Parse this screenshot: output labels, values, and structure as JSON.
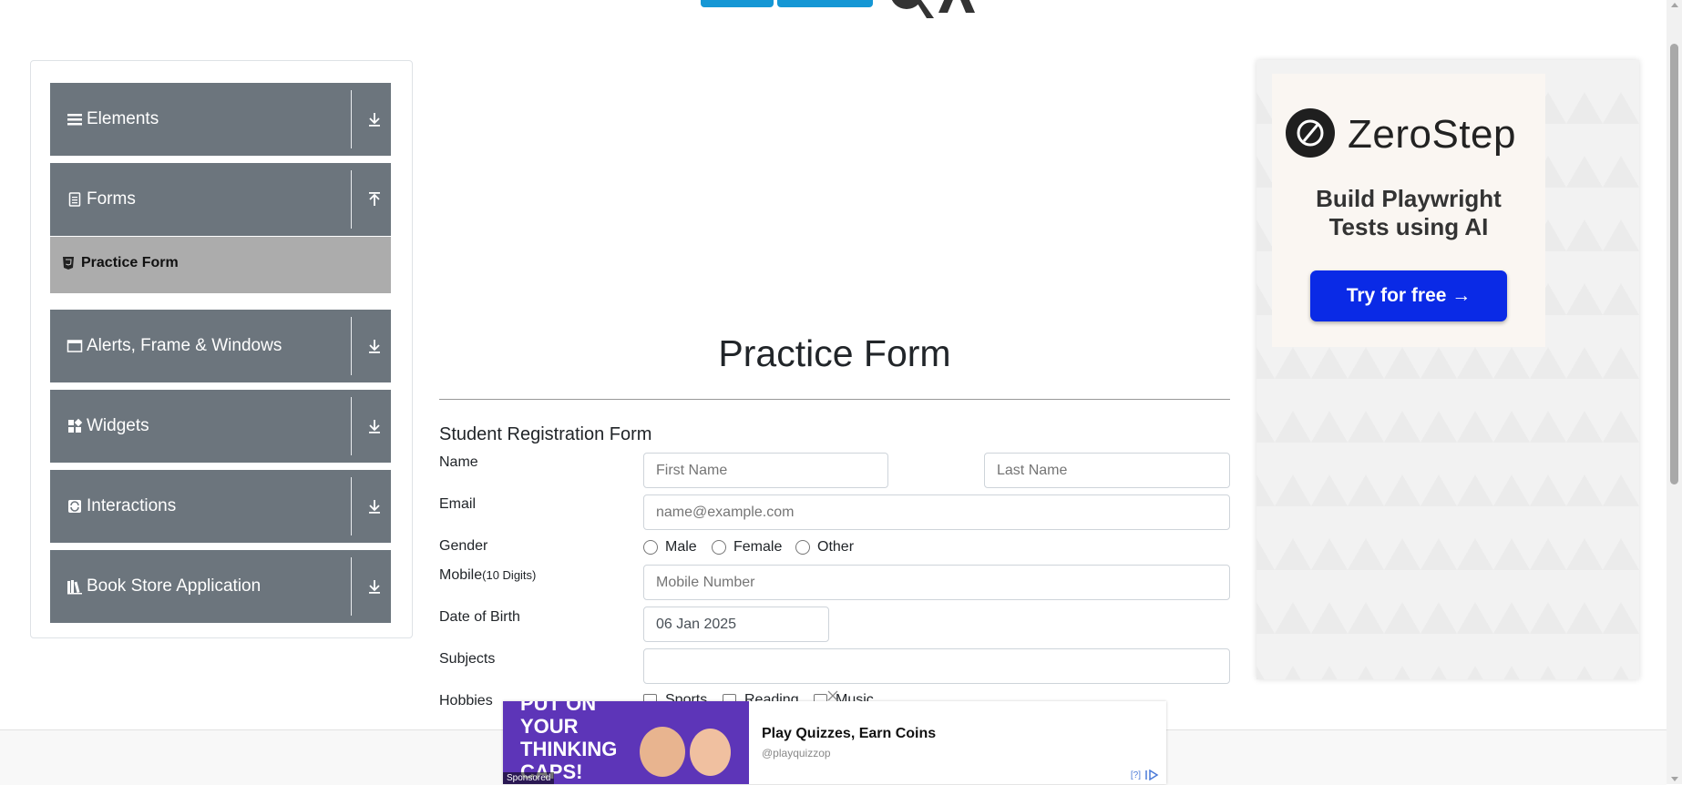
{
  "sidebar": {
    "groups": [
      {
        "label": "Elements",
        "icon": "hamburger-icon",
        "toggle": "collapse-arrow-down"
      },
      {
        "label": "Forms",
        "icon": "document-icon",
        "toggle": "expand-arrow-up"
      },
      {
        "label": "Alerts, Frame & Windows",
        "icon": "window-icon",
        "toggle": "collapse-arrow-down"
      },
      {
        "label": "Widgets",
        "icon": "widgets-icon",
        "toggle": "collapse-arrow-down"
      },
      {
        "label": "Interactions",
        "icon": "interactions-icon",
        "toggle": "collapse-arrow-down"
      },
      {
        "label": "Book Store Application",
        "icon": "books-icon",
        "toggle": "collapse-arrow-down"
      }
    ],
    "active_item": {
      "label": "Practice Form",
      "icon": "html5-icon"
    }
  },
  "main": {
    "page_title": "Practice Form",
    "form_title": "Student Registration Form",
    "name_label": "Name",
    "first_name_placeholder": "First Name",
    "last_name_placeholder": "Last Name",
    "email_label": "Email",
    "email_placeholder": "name@example.com",
    "gender_label": "Gender",
    "gender_options": [
      "Male",
      "Female",
      "Other"
    ],
    "mobile_label": "Mobile",
    "mobile_hint": "(10 Digits)",
    "mobile_placeholder": "Mobile Number",
    "dob_label": "Date of Birth",
    "dob_value": "06 Jan 2025",
    "subjects_label": "Subjects",
    "subjects_value": "",
    "hobbies_label": "Hobbies",
    "hobbies_options": [
      "Sports",
      "Reading",
      "Music"
    ]
  },
  "ad_right": {
    "brand": "ZeroStep",
    "tagline_line1": "Build Playwright",
    "tagline_line2": "Tests using AI",
    "button_label": "Try for free →"
  },
  "ad_bottom": {
    "image_text_line1": "PUT ON",
    "image_text_line2": "YOUR",
    "image_text_line3": "THINKING",
    "image_text_line4": "CAPS!",
    "sponsored": "Sponsored",
    "title": "Play Quizzes, Earn Coins",
    "handle": "@playquizzop",
    "info": "[?]"
  },
  "colors": {
    "sidebar_group_bg": "#6c757d",
    "sidebar_active_bg": "#acacac",
    "brand_blue": "#1597d5",
    "cta_blue": "#0a2ae6"
  }
}
